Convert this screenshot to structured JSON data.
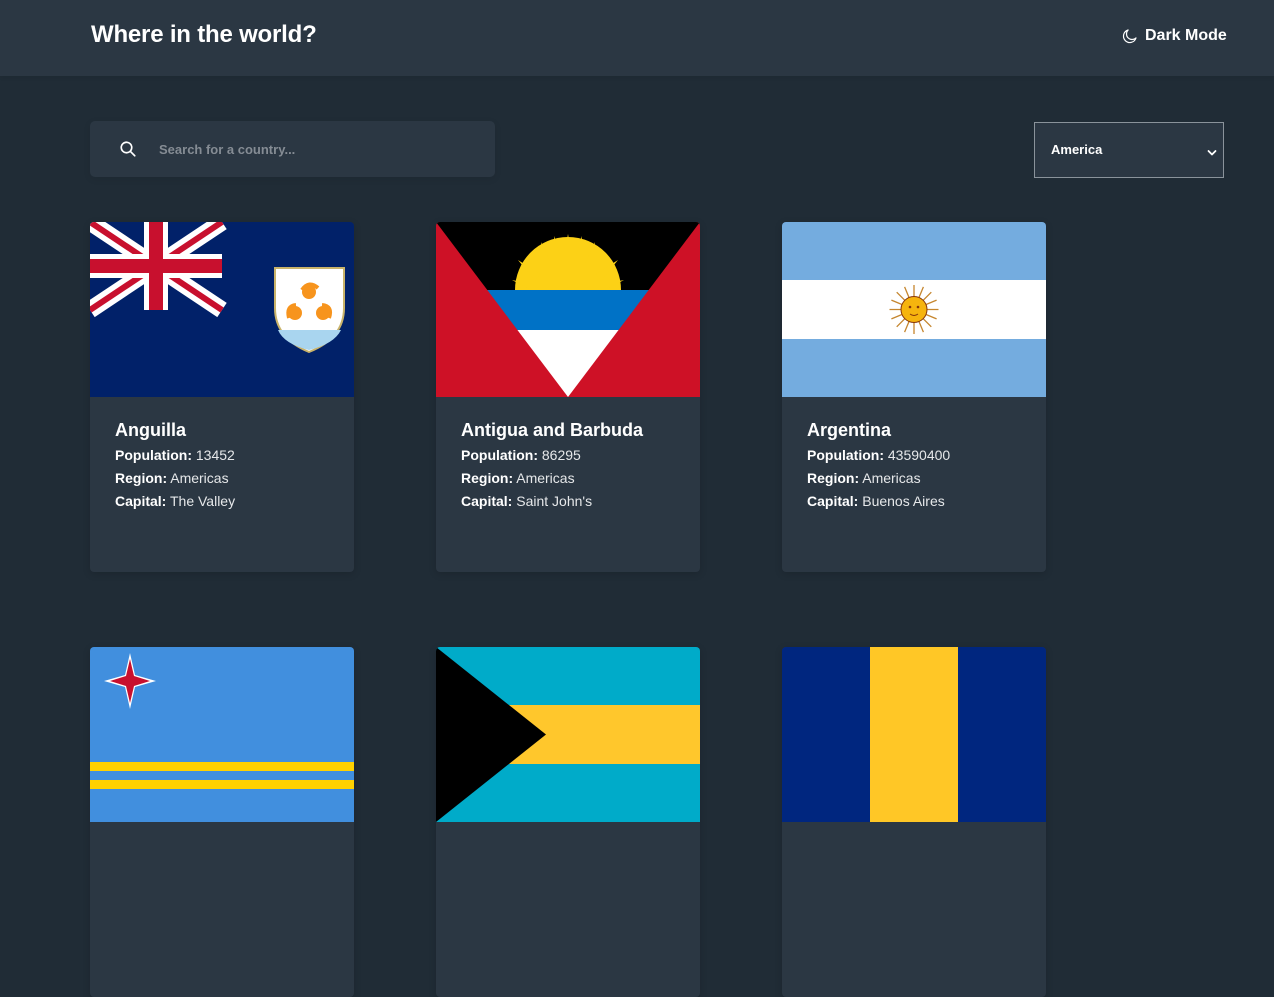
{
  "header": {
    "title": "Where in the world?",
    "theme_toggle_label": "Dark Mode",
    "theme_icon": "moon-icon"
  },
  "search": {
    "placeholder": "Search for a country...",
    "value": "",
    "icon": "search-icon"
  },
  "filter": {
    "selected": "America",
    "icon": "chevron-down-icon"
  },
  "labels": {
    "population": "Population:",
    "region": "Region:",
    "capital": "Capital:"
  },
  "countries": [
    {
      "name": "Anguilla",
      "population": "13452",
      "region": "Americas",
      "capital": "The Valley",
      "flag": "anguilla-flag"
    },
    {
      "name": "Antigua and Barbuda",
      "population": "86295",
      "region": "Americas",
      "capital": "Saint John's",
      "flag": "antigua-and-barbuda-flag"
    },
    {
      "name": "Argentina",
      "population": "43590400",
      "region": "Americas",
      "capital": "Buenos Aires",
      "flag": "argentina-flag"
    },
    {
      "name": "",
      "population": "",
      "region": "",
      "capital": "",
      "flag": "aruba-flag"
    },
    {
      "name": "",
      "population": "",
      "region": "",
      "capital": "",
      "flag": "bahamas-flag"
    },
    {
      "name": "",
      "population": "",
      "region": "",
      "capital": "",
      "flag": "barbados-flag"
    }
  ],
  "colors": {
    "background": "#202c36",
    "surface": "#2b3743",
    "text": "#ffffff",
    "placeholder": "#858c94"
  }
}
